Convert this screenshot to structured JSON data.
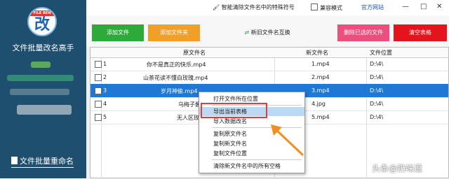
{
  "app": {
    "logo_ribbon": "FILE REN",
    "logo_glyph": "改",
    "title": "文件批量改名高手",
    "bottom_label": "文件批量重命名"
  },
  "topbar": {
    "smart_clean": "智能清除文件名中的特殊符号",
    "compat_mode": "兼容模式",
    "website": "官方网站",
    "min_label": "—",
    "max_label": "□",
    "close_label": "✕"
  },
  "buttons": {
    "add_file": "添加文件",
    "add_folder": "添加文件夹",
    "swap": "新旧文件名互换",
    "delete_selected": "删除已选的文件",
    "clear_table": "清空表格"
  },
  "table": {
    "headers": [
      "原文件名",
      "新文件名",
      "文件位置"
    ],
    "rows": [
      {
        "num": "1",
        "orig": "你不是真正的快乐.mp4",
        "new": "1.mp4",
        "loc": "D:\\4\\"
      },
      {
        "num": "2",
        "orig": "山茶花读不懂白玫瑰.mp4",
        "new": "2.mp4",
        "loc": "D:\\4\\"
      },
      {
        "num": "3",
        "orig": "岁月神偷.mp4",
        "new": "3.mp4",
        "loc": "D:\\4\\"
      },
      {
        "num": "4",
        "orig": "乌梅子酱",
        "new": "4.jpg",
        "loc": "D:\\4\\"
      },
      {
        "num": "5",
        "orig": "无人区玫瑰",
        "new": "5.mp4",
        "loc": "D:\\4\\"
      }
    ]
  },
  "context_menu": {
    "items": [
      "打开文件所在位置",
      "导出当前表格",
      "导入数据改名",
      "复制原文件名",
      "复制新文件名",
      "复制文件位置",
      "清除新文件名中的所有空格"
    ]
  },
  "watermark": "头条@奶味逗",
  "colors": {
    "sidebar": "#1f4f6f",
    "add_file": "#2eaa3a",
    "add_folder": "#f0a028",
    "delete_selected": "#ec4f7e",
    "clear_table": "#e3141c",
    "selection": "#1e78d4",
    "highlight_box": "#e53b3b",
    "arrow": "#f0901e"
  }
}
